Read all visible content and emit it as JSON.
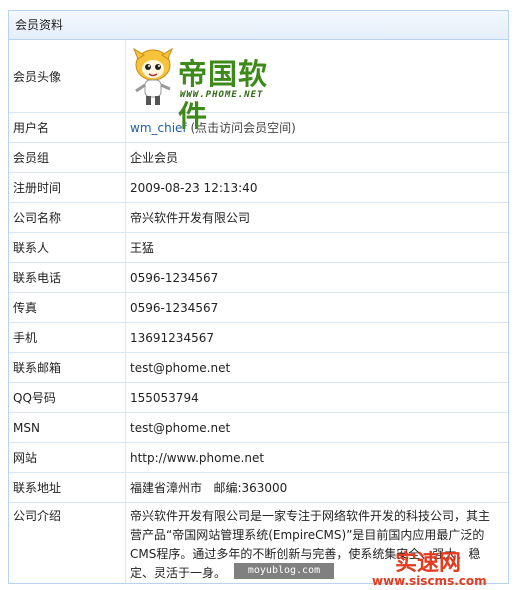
{
  "panel": {
    "title": "会员资料"
  },
  "logo": {
    "text": "帝国软件",
    "sub": "WWW.PHOME.NET"
  },
  "rows": {
    "avatar_label": "会员头像",
    "username_label": "用户名",
    "username": "wm_chief",
    "username_hint": "(点击访问会员空间)",
    "group_label": "会员组",
    "group": "企业会员",
    "regtime_label": "注册时间",
    "regtime": "2009-08-23 12:13:40",
    "company_label": "公司名称",
    "company": "帝兴软件开发有限公司",
    "contact_label": "联系人",
    "contact": "王猛",
    "phone_label": "联系电话",
    "phone": "0596-1234567",
    "fax_label": "传真",
    "fax": "0596-1234567",
    "mobile_label": "手机",
    "mobile": "13691234567",
    "email_label": "联系邮箱",
    "email": "test@phome.net",
    "qq_label": "QQ号码",
    "qq": "155053794",
    "msn_label": "MSN",
    "msn": "test@phome.net",
    "website_label": "网站",
    "website": "http://www.phome.net",
    "address_label": "联系地址",
    "address": "福建省漳州市   邮编:363000",
    "intro_label": "公司介绍",
    "intro": "帝兴软件开发有限公司是一家专注于网络软件开发的科技公司，其主营产品“帝国网站管理系统(EmpireCMS)”是目前国内应用最广泛的CMS程序。通过多年的不断创新与完善，使系统集安全、强大、稳定、灵活于一身。"
  },
  "watermarks": {
    "a": "moyublog.com",
    "b1": "实速网",
    "b2": "www.siscms.com"
  }
}
